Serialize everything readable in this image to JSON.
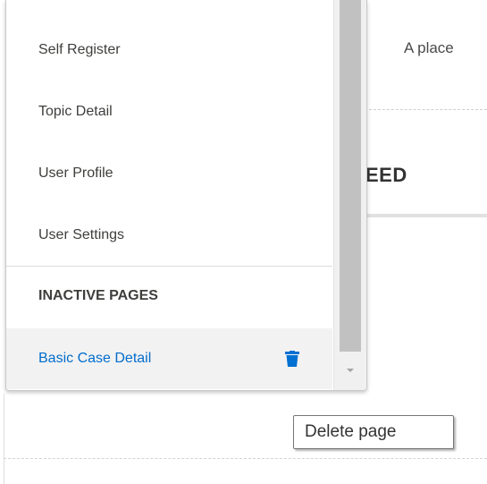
{
  "background": {
    "placeholder_text": "A place",
    "feed_heading": "EED"
  },
  "menu": {
    "items": [
      {
        "label": "Self Register"
      },
      {
        "label": "Topic Detail"
      },
      {
        "label": "User Profile"
      },
      {
        "label": "User Settings"
      }
    ],
    "inactive_section": {
      "header": "INACTIVE PAGES",
      "items": [
        {
          "label": "Basic Case Detail",
          "icon": "trash-icon"
        }
      ]
    }
  },
  "tooltip": {
    "text": "Delete page"
  },
  "colors": {
    "link_blue": "#006dcc",
    "trash_icon": "#0070d2",
    "selected_row_bg": "#f3f2f2"
  }
}
